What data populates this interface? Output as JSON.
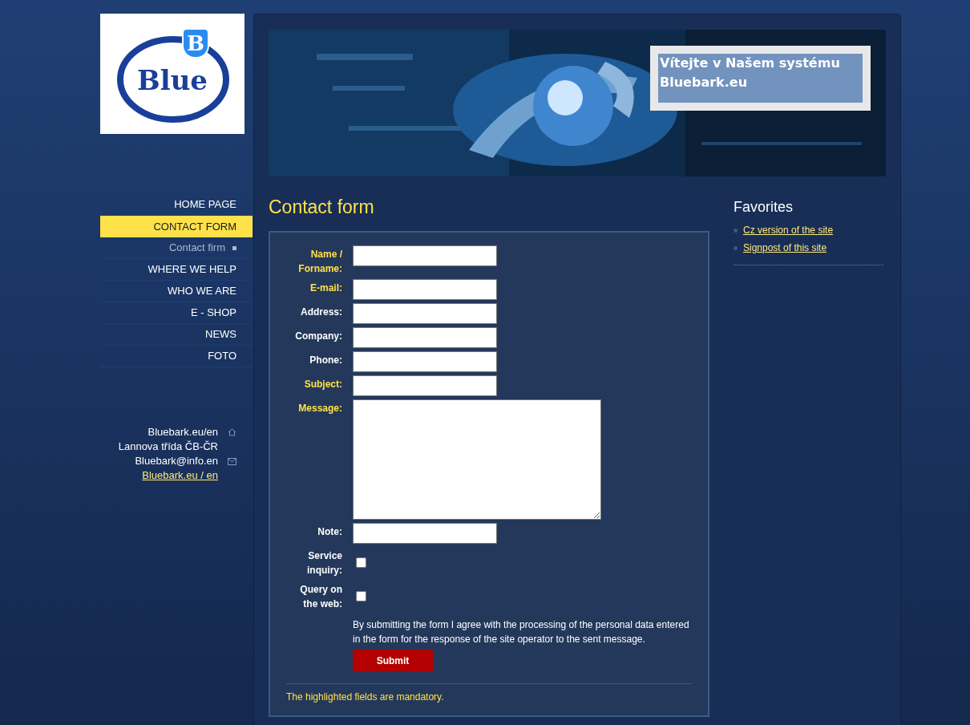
{
  "logo": {
    "word": "Blue",
    "badge": "B"
  },
  "nav": [
    {
      "label": "HOME PAGE",
      "selected": false,
      "kind": "item"
    },
    {
      "label": "CONTACT FORM",
      "selected": true,
      "kind": "item"
    },
    {
      "label": "Contact firm",
      "selected": false,
      "kind": "sub"
    },
    {
      "label": "WHERE WE HELP",
      "selected": false,
      "kind": "item"
    },
    {
      "label": "WHO WE ARE",
      "selected": false,
      "kind": "item"
    },
    {
      "label": "E - SHOP",
      "selected": false,
      "kind": "item"
    },
    {
      "label": "NEWS",
      "selected": false,
      "kind": "item"
    },
    {
      "label": "FOTO",
      "selected": false,
      "kind": "item"
    }
  ],
  "address": [
    {
      "text": "Bluebark.eu/en",
      "kind": "home"
    },
    {
      "text": "Lannova třída ČB-ČR",
      "kind": "plain"
    },
    {
      "text": "Bluebark@info.en",
      "kind": "mail"
    },
    {
      "text": "Bluebark.eu / en",
      "kind": "link"
    }
  ],
  "banner": {
    "title": "Vítejte v Našem systému Bluebark.eu"
  },
  "heading": "Contact form",
  "form": {
    "fields": [
      {
        "label": "Name / Forname:",
        "kind": "text",
        "required": true
      },
      {
        "label": "E-mail:",
        "kind": "text",
        "required": true
      },
      {
        "label": "Address:",
        "kind": "text",
        "required": false
      },
      {
        "label": "Company:",
        "kind": "text",
        "required": false
      },
      {
        "label": "Phone:",
        "kind": "text",
        "required": false
      },
      {
        "label": "Subject:",
        "kind": "text",
        "required": true
      },
      {
        "label": "Message:",
        "kind": "textarea",
        "required": true
      },
      {
        "label": "Note:",
        "kind": "text",
        "required": false
      },
      {
        "label": "Service inquiry:",
        "kind": "checkbox",
        "required": false,
        "checked": false
      },
      {
        "label": "Query on the web:",
        "kind": "checkbox",
        "required": false,
        "checked": false
      }
    ],
    "consent": "By submitting the form I agree with the processing of the personal data entered in the form for the response of the site operator to the sent message.",
    "submit": "Submit",
    "footnote": "The highlighted fields are mandatory."
  },
  "favorites": {
    "title": "Favorites",
    "links": [
      "Cz version of the site",
      "Signpost of this site"
    ]
  }
}
